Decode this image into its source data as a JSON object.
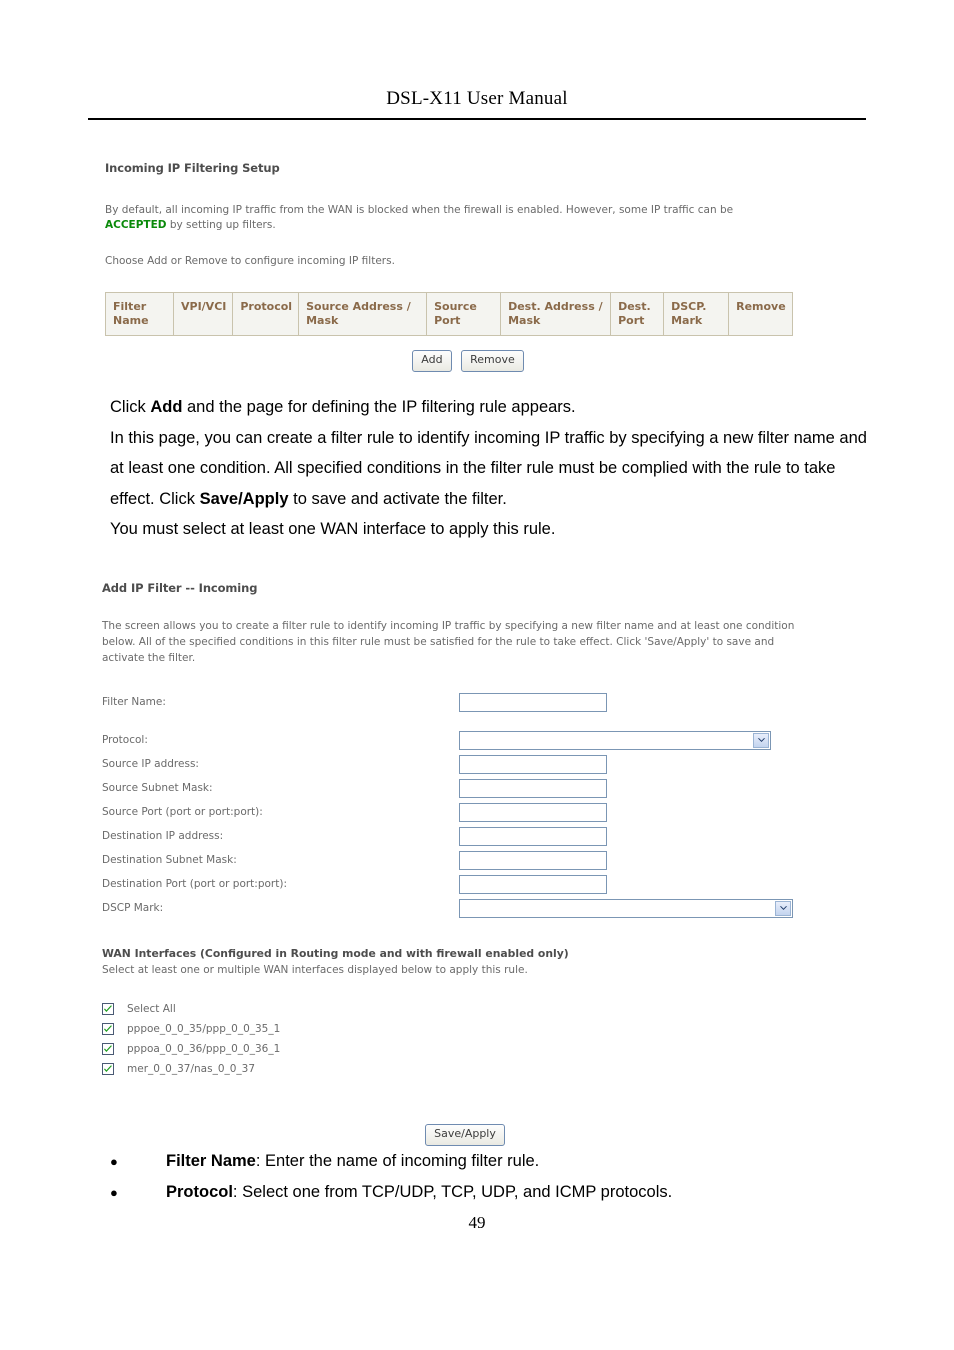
{
  "document": {
    "header_title": "DSL-X11 User Manual",
    "page_number": "49"
  },
  "incoming_filter_screen": {
    "heading": "Incoming IP Filtering Setup",
    "intro_before": "By default, all incoming IP traffic from the WAN is blocked when the firewall is enabled. However, some IP traffic can be",
    "intro_highlight": "ACCEPTED",
    "intro_after": "by setting up filters.",
    "highlight_color": "#0a8a0a",
    "choose_line": "Choose Add or Remove to configure incoming IP filters.",
    "table": {
      "columns": [
        "Filter Name",
        "VPI/VCI",
        "Protocol",
        "Source Address / Mask",
        "Source Port",
        "Dest. Address / Mask",
        "Dest. Port",
        "DSCP. Mark",
        "Remove"
      ],
      "rows": []
    },
    "buttons": {
      "add": "Add",
      "remove": "Remove"
    }
  },
  "manual_body": {
    "line1_pre": "Click ",
    "line1_bold": "Add",
    "line1_post": " and the page for defining the IP filtering rule appears.",
    "line2_pre": "In this page, you can create a filter rule to identify incoming IP traffic by specifying a new filter name and at least one condition. All specified conditions in the filter rule must be complied with the rule to take effect. Click ",
    "line2_bold": "Save/Apply",
    "line2_post": " to save and activate the filter.",
    "line3": "You must select at least one WAN interface to apply this rule."
  },
  "add_filter_screen": {
    "heading": "Add IP Filter -- Incoming",
    "intro": "The screen allows you to create a filter rule to identify incoming IP traffic by specifying a new filter name and at least one condition below. All of the specified conditions in this filter rule must be satisfied for the rule to take effect. Click 'Save/Apply' to save and activate the filter.",
    "fields": {
      "filter_name": {
        "label": "Filter Name:",
        "value": "",
        "type": "text"
      },
      "protocol": {
        "label": "Protocol:",
        "value": "",
        "type": "select"
      },
      "source_ip": {
        "label": "Source IP address:",
        "value": "",
        "type": "text"
      },
      "source_mask": {
        "label": "Source Subnet Mask:",
        "value": "",
        "type": "text"
      },
      "source_port": {
        "label": "Source Port (port or port:port):",
        "value": "",
        "type": "text"
      },
      "dest_ip": {
        "label": "Destination IP address:",
        "value": "",
        "type": "text"
      },
      "dest_mask": {
        "label": "Destination Subnet Mask:",
        "value": "",
        "type": "text"
      },
      "dest_port": {
        "label": "Destination Port (port or port:port):",
        "value": "",
        "type": "text"
      },
      "dscp_mark": {
        "label": "DSCP Mark:",
        "value": "",
        "type": "select"
      }
    },
    "wan": {
      "title": "WAN Interfaces (Configured in Routing mode and with firewall enabled only)",
      "subtitle": "Select at least one or multiple WAN interfaces displayed below to apply this rule.",
      "interfaces": [
        {
          "label": "Select All",
          "checked": true
        },
        {
          "label": "pppoe_0_0_35/ppp_0_0_35_1",
          "checked": true
        },
        {
          "label": "pppoa_0_0_36/ppp_0_0_36_1",
          "checked": true
        },
        {
          "label": "mer_0_0_37/nas_0_0_37",
          "checked": true
        }
      ],
      "check_color": "#1c9c1c"
    },
    "save_button": "Save/Apply"
  },
  "bullets": [
    {
      "marker": "●",
      "bold": "Filter Name",
      "rest": ": Enter the name of incoming filter rule."
    },
    {
      "marker": "●",
      "bold": "Protocol",
      "rest": ": Select one from TCP/UDP, TCP, UDP, and ICMP protocols."
    }
  ]
}
